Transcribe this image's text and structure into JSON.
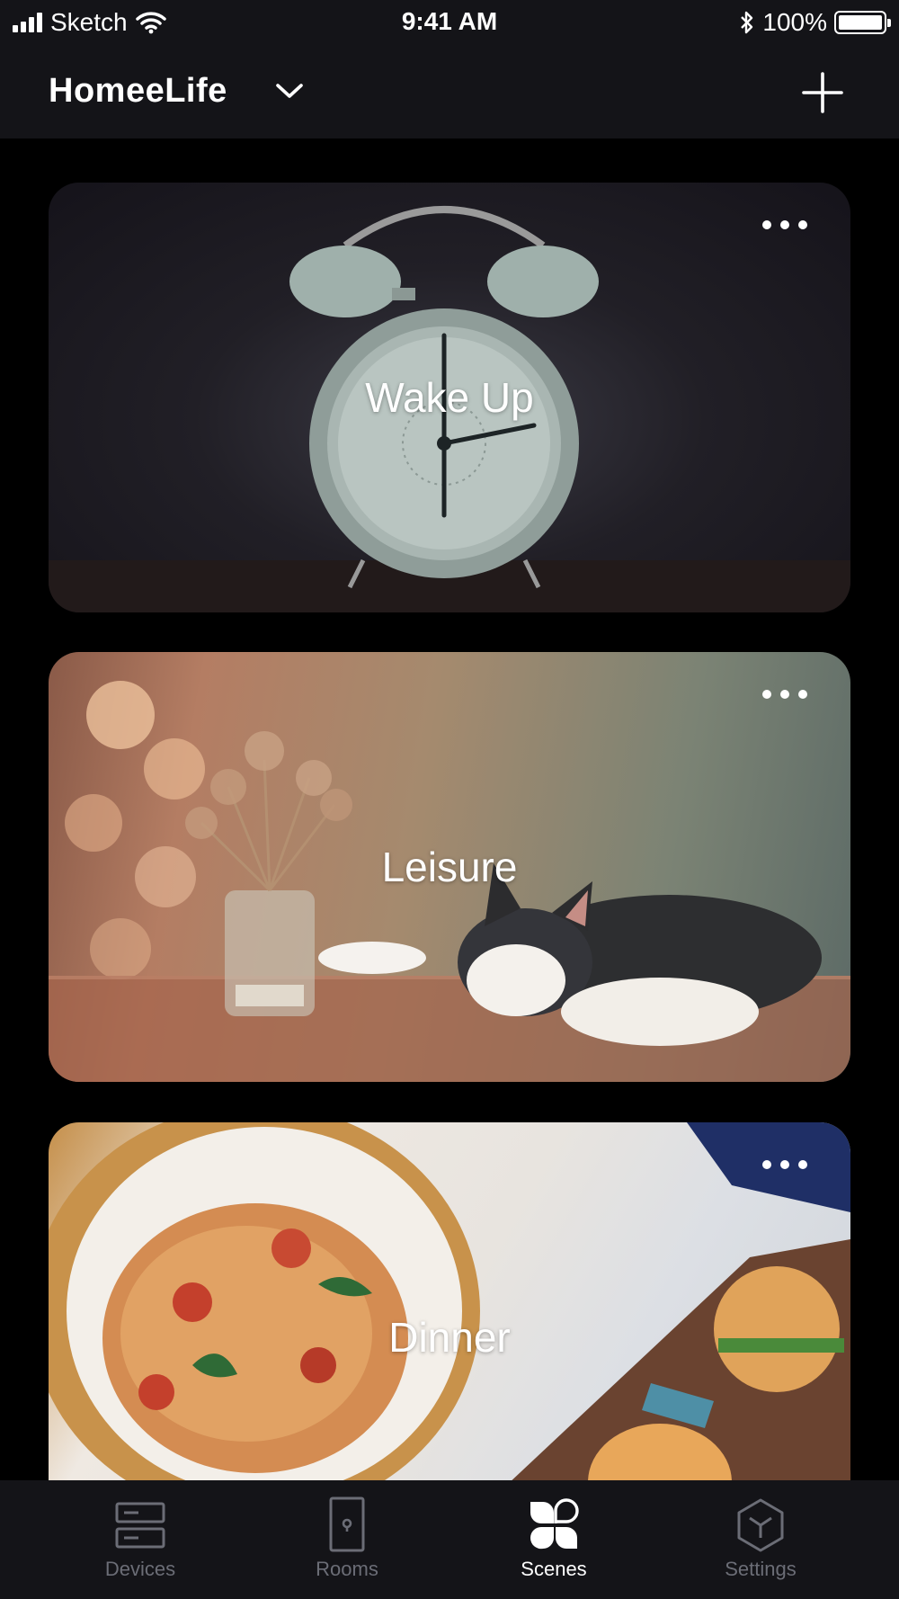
{
  "status_bar": {
    "carrier": "Sketch",
    "time": "9:41 AM",
    "battery": "100%",
    "icons": [
      "signal-icon",
      "wifi-icon",
      "bluetooth-icon",
      "battery-icon"
    ]
  },
  "header": {
    "home_name": "HomeeLife",
    "icons": [
      "chevron-down-icon",
      "plus-icon"
    ]
  },
  "scenes": [
    {
      "label": "Wake Up",
      "menu_icon": "more-icon"
    },
    {
      "label": "Leisure",
      "menu_icon": "more-icon"
    },
    {
      "label": "Dinner",
      "menu_icon": "more-icon"
    }
  ],
  "tabs": [
    {
      "label": "Devices",
      "icon": "devices-icon",
      "active": false
    },
    {
      "label": "Rooms",
      "icon": "door-icon",
      "active": false
    },
    {
      "label": "Scenes",
      "icon": "scenes-icon",
      "active": true
    },
    {
      "label": "Settings",
      "icon": "settings-icon",
      "active": false
    }
  ],
  "colors": {
    "background": "#000000",
    "bar_background": "#141418",
    "active_tab": "#ffffff",
    "inactive_tab": "#6b6d76"
  }
}
